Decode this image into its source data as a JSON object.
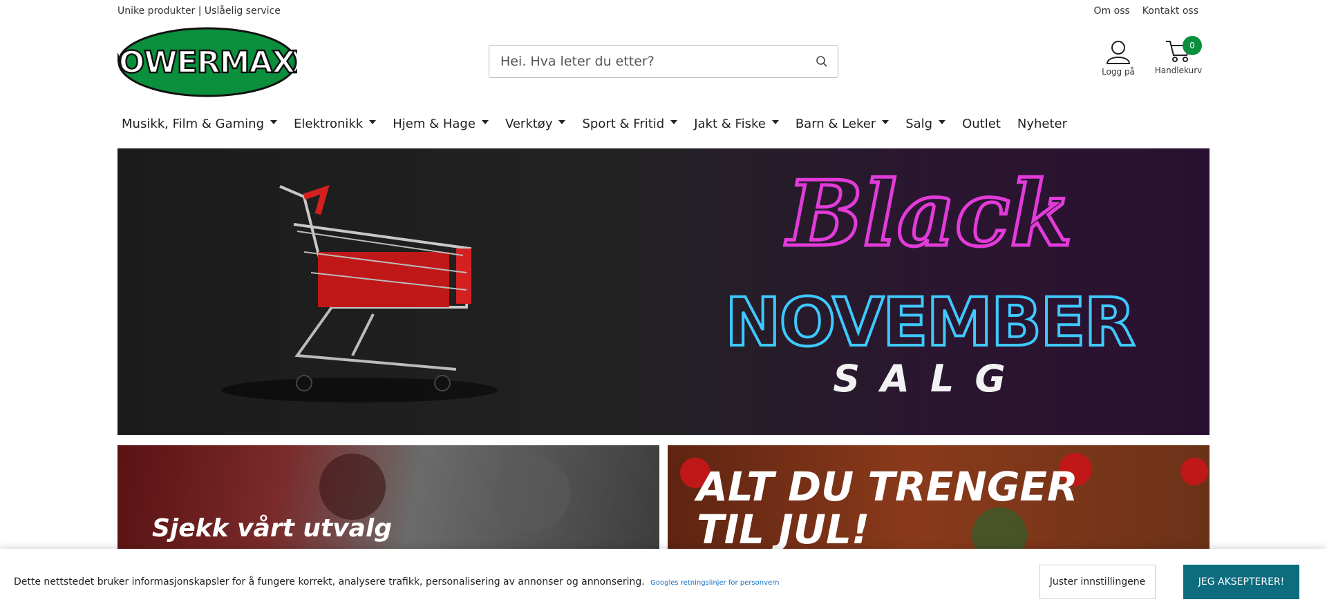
{
  "topbar": {
    "tagline": "Unike produkter | Uslåelig service",
    "links": [
      "Om oss",
      "Kontakt oss"
    ]
  },
  "brand": {
    "logo_text": "POWERMAXX",
    "logo_color": "#0a8f3c"
  },
  "search": {
    "placeholder": "Hei. Hva leter du etter?",
    "value": ""
  },
  "account": {
    "label": "Logg på"
  },
  "cart": {
    "label": "Handlekurv",
    "count": "0"
  },
  "nav": {
    "items": [
      {
        "label": "Musikk, Film & Gaming",
        "dropdown": true
      },
      {
        "label": "Elektronikk",
        "dropdown": true
      },
      {
        "label": "Hjem & Hage",
        "dropdown": true
      },
      {
        "label": "Verktøy",
        "dropdown": true
      },
      {
        "label": "Sport & Fritid",
        "dropdown": true
      },
      {
        "label": "Jakt & Fiske",
        "dropdown": true
      },
      {
        "label": "Barn & Leker",
        "dropdown": true
      },
      {
        "label": "Salg",
        "dropdown": true
      },
      {
        "label": "Outlet",
        "dropdown": false
      },
      {
        "label": "Nyheter",
        "dropdown": false
      }
    ]
  },
  "hero": {
    "line1": "Black",
    "line2": "NOVEMBER",
    "line3": "SALG"
  },
  "promos": [
    {
      "text": "Sjekk vårt utvalg"
    },
    {
      "text_line1": "ALT DU TRENGER",
      "text_line2": "TIL JUL!"
    }
  ],
  "cookie": {
    "message": "Dette nettstedet bruker informasjonskapsler for å fungere korrekt, analysere trafikk, personalisering av annonser og annonsering.",
    "policy_link": "Googles retningslinjer for personvern",
    "adjust_label": "Juster innstillingene",
    "accept_label": "JEG AKSEPTERER!"
  },
  "colors": {
    "accent_green": "#0a8f3c",
    "accept_button": "#0d6c7e",
    "neon_pink": "#e23bd9",
    "neon_cyan": "#3ec9ff"
  }
}
